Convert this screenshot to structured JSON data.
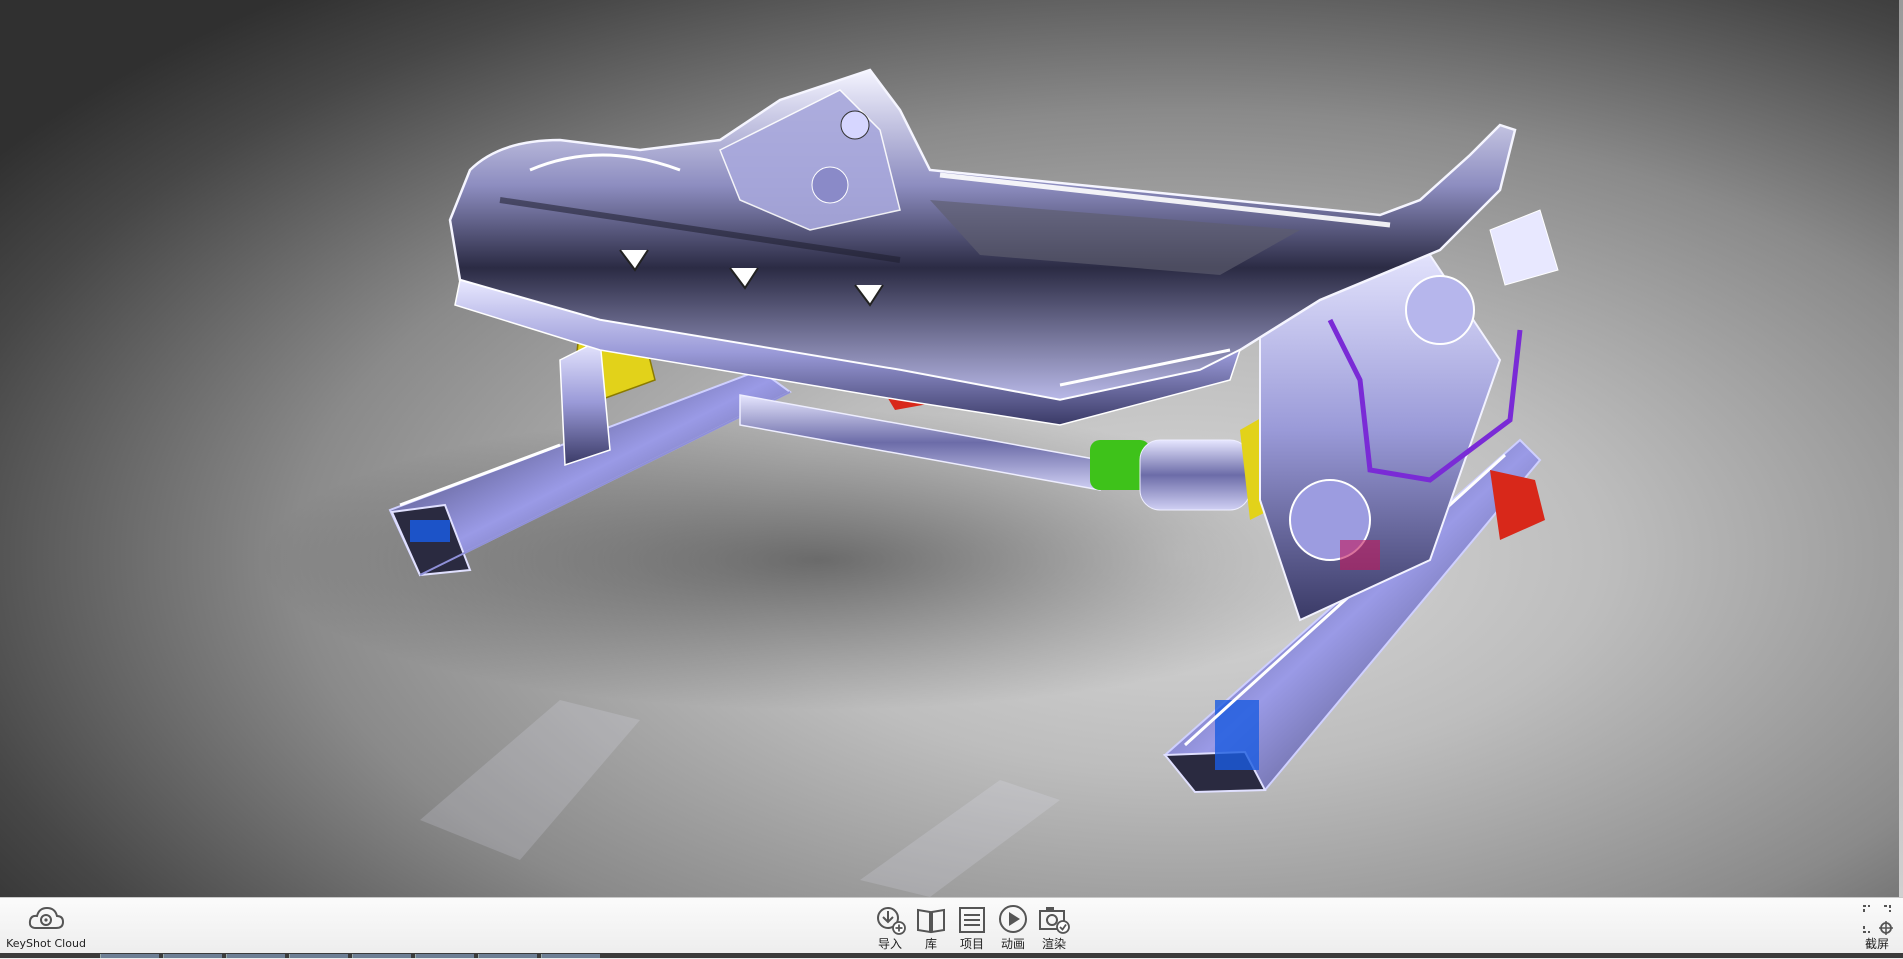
{
  "toolbar": {
    "keyshot_cloud": {
      "label": "KeyShot Cloud",
      "icon": "cloud-gear-icon"
    },
    "items": [
      {
        "label": "导入",
        "icon": "import-icon"
      },
      {
        "label": "库",
        "icon": "library-book-icon"
      },
      {
        "label": "项目",
        "icon": "project-list-icon"
      },
      {
        "label": "动画",
        "icon": "animation-play-icon"
      },
      {
        "label": "渲染",
        "icon": "render-camera-icon"
      }
    ],
    "screenshot": {
      "label": "截屏",
      "icon": "screenshot-capture-icon"
    }
  },
  "colors": {
    "toolbar_bg": "#f2f2f2",
    "icon_stroke": "#555555",
    "chrome": "#c9c9f0",
    "yellow_part": "#e2d21a",
    "red_part": "#d8281a",
    "green_part": "#3ec21a",
    "purple_tube": "#7a2bd6",
    "blue_part": "#1a5be0"
  }
}
